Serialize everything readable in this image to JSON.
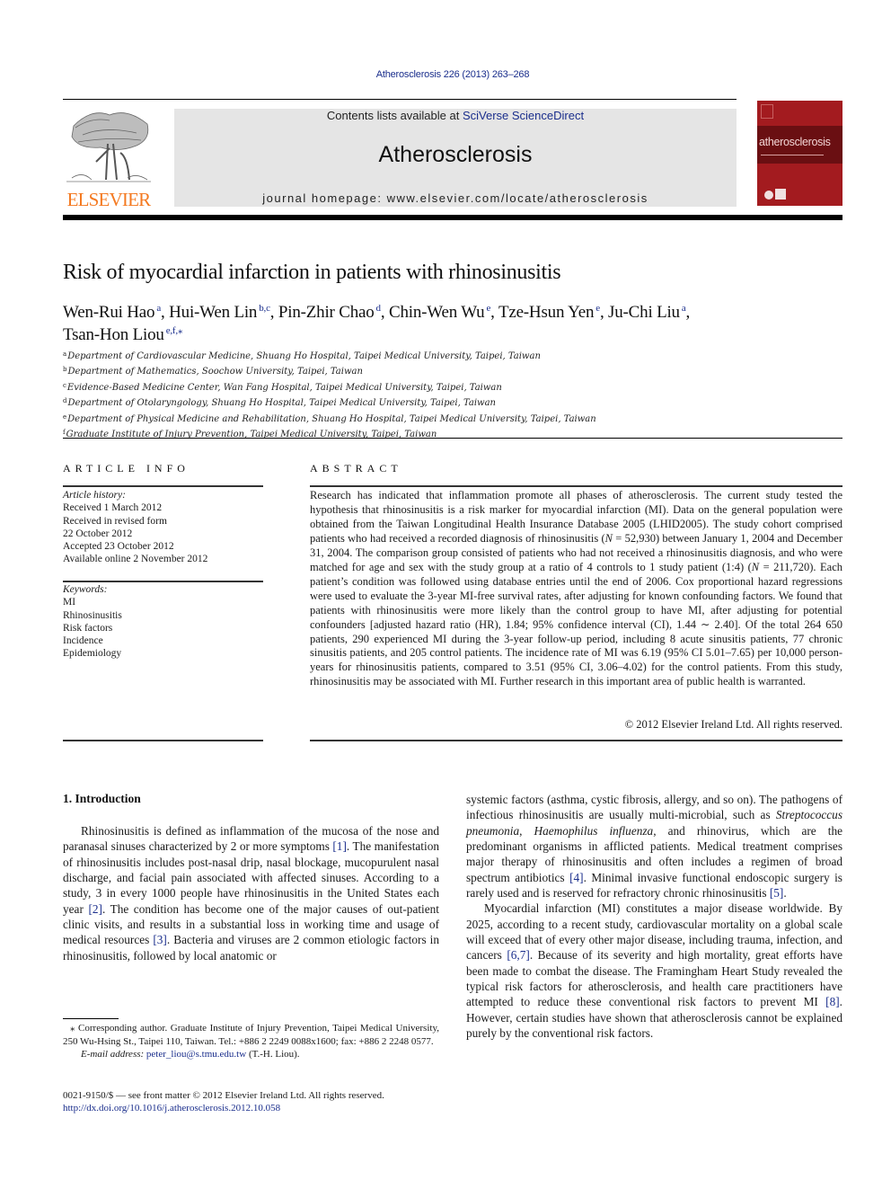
{
  "header": {
    "citation": "Atherosclerosis 226 (2013) 263–268",
    "publisher": "ELSEVIER",
    "contents_prefix": "Contents lists available at ",
    "contents_link": "SciVerse ScienceDirect",
    "journal_name": "Atherosclerosis",
    "homepage": "journal homepage: www.elsevier.com/locate/atherosclerosis",
    "cover_title": "atherosclerosis",
    "colors": {
      "publisher_orange": "#f47920",
      "link_blue": "#1a2e8c",
      "cover_red": "#a31b1f",
      "band_gray": "#e5e5e5"
    }
  },
  "article": {
    "title": "Risk of myocardial infarction in patients with rhinosinusitis",
    "authors": [
      {
        "name": "Wen-Rui Hao",
        "sup": "a",
        "sep": ", "
      },
      {
        "name": "Hui-Wen Lin",
        "sup": "b,c",
        "sep": ", "
      },
      {
        "name": "Pin-Zhir Chao",
        "sup": "d",
        "sep": ", "
      },
      {
        "name": "Chin-Wen Wu",
        "sup": "e",
        "sep": ", "
      },
      {
        "name": "Tze-Hsun Yen",
        "sup": "e",
        "sep": ", "
      },
      {
        "name": "Ju-Chi Liu",
        "sup": "a",
        "sep": ","
      },
      {
        "name": "Tsan-Hon Liou",
        "sup": "e,f,⁎",
        "sep": ""
      }
    ],
    "affiliations": [
      {
        "key": "a",
        "text": "Department of Cardiovascular Medicine, Shuang Ho Hospital, Taipei Medical University, Taipei, Taiwan"
      },
      {
        "key": "b",
        "text": "Department of Mathematics, Soochow University, Taipei, Taiwan"
      },
      {
        "key": "c",
        "text": "Evidence-Based Medicine Center, Wan Fang Hospital, Taipei Medical University, Taipei, Taiwan"
      },
      {
        "key": "d",
        "text": "Department of Otolaryngology, Shuang Ho Hospital, Taipei Medical University, Taipei, Taiwan"
      },
      {
        "key": "e",
        "text": "Department of Physical Medicine and Rehabilitation, Shuang Ho Hospital, Taipei Medical University, Taipei, Taiwan"
      },
      {
        "key": "f",
        "text": "Graduate Institute of Injury Prevention, Taipei Medical University, Taipei, Taiwan"
      }
    ]
  },
  "article_info": {
    "heading": "ARTICLE INFO",
    "history_label": "Article history:",
    "history": [
      "Received 1 March 2012",
      "Received in revised form",
      "22 October 2012",
      "Accepted 23 October 2012",
      "Available online 2 November 2012"
    ],
    "keywords_label": "Keywords:",
    "keywords": [
      "MI",
      "Rhinosinusitis",
      "Risk factors",
      "Incidence",
      "Epidemiology"
    ]
  },
  "abstract": {
    "heading": "ABSTRACT",
    "p1": "Research has indicated that inflammation promote all phases of atherosclerosis. The current study tested the hypothesis that rhinosinusitis is a risk marker for myocardial infarction (MI). Data on the general population were obtained from the Taiwan Longitudinal Health Insurance Database 2005 (LHID2005). The study cohort comprised patients who had received a recorded diagnosis of rhinosinusitis (",
    "n_var": "N",
    "p2": " = 52,930) between January 1, 2004 and December 31, 2004. The comparison group consisted of patients who had not received a rhinosinusitis diagnosis, and who were matched for age and sex with the study group at a ratio of 4 controls to 1 study patient (1:4) (",
    "p3": " = 211,720). Each patient’s condition was followed using database entries until the end of 2006. Cox proportional hazard regressions were used to evaluate the 3-year MI-free survival rates, after adjusting for known confounding factors. We found that patients with rhinosinusitis were more likely than the control group to have MI, after adjusting for potential confounders [adjusted hazard ratio (HR), 1.84; 95% confidence interval (CI), 1.44 ∼ 2.40]. Of the total 264 650 patients, 290 experienced MI during the 3-year follow-up period, including 8 acute sinusitis patients, 77 chronic sinusitis patients, and 205 control patients. The incidence rate of MI was 6.19 (95% CI 5.01–7.65) per 10,000 person-years for rhinosinusitis patients, compared to 3.51 (95% CI, 3.06–4.02) for the control patients. From this study, rhinosinusitis may be associated with MI. Further research in this important area of public health is warranted.",
    "copyright": "© 2012 Elsevier Ireland Ltd. All rights reserved."
  },
  "body": {
    "section_heading": "1.  Introduction",
    "left": {
      "s1": "Rhinosinusitis is defined as inflammation of the mucosa of the nose and paranasal sinuses characterized by 2 or more symptoms ",
      "r1": "[1]",
      "s2": ". The manifestation of rhinosinusitis includes post-nasal drip, nasal blockage, mucopurulent nasal discharge, and facial pain associated with affected sinuses. According to a study, 3 in every 1000 people have rhinosinusitis in the United States each year ",
      "r2": "[2]",
      "s3": ". The condition has become one of the major causes of out-patient clinic visits, and results in a substantial loss in working time and usage of medical resources ",
      "r3": "[3]",
      "s4": ". Bacteria and viruses are 2 common etiologic factors in rhinosinusitis, followed by local anatomic or"
    },
    "right": {
      "s1": "systemic factors (asthma, cystic fibrosis, allergy, and so on). The pathogens of infectious rhinosinusitis are usually multi-microbial, such as ",
      "i1": "Streptococcus pneumonia",
      "s2": ", ",
      "i2": "Haemophilus influenza",
      "s3": ", and rhinovirus, which are the predominant organisms in afflicted patients. Medical treatment comprises major therapy of rhinosinusitis and often includes a regimen of broad spectrum antibiotics ",
      "r4": "[4]",
      "s4": ". Minimal invasive functional endoscopic surgery is rarely used and is reserved for refractory chronic rhinosinusitis ",
      "r5": "[5]",
      "s5": ".",
      "p2a": "Myocardial infarction (MI) constitutes a major disease worldwide. By 2025, according to a recent study, cardiovascular mortality on a global scale will exceed that of every other major disease, including trauma, infection, and cancers ",
      "r67": "[6,7]",
      "p2b": ". Because of its severity and high mortality, great efforts have been made to combat the disease. The Framingham Heart Study revealed the typical risk factors for atherosclerosis, and health care practitioners have attempted to reduce these conventional risk factors to prevent MI ",
      "r8": "[8]",
      "p2c": ". However, certain studies have shown that atherosclerosis cannot be explained purely by the conventional risk factors."
    }
  },
  "footnote": {
    "corresponding": "⁎ Corresponding author. Graduate Institute of Injury Prevention, Taipei Medical University, 250 Wu-Hsing St., Taipei 110, Taiwan. Tel.: +886 2 2249 0088x1600; fax: +886 2 2248 0577.",
    "email_label": "E-mail address: ",
    "email": "peter_liou@s.tmu.edu.tw",
    "email_suffix": " (T.-H. Liou).",
    "front_matter": "0021-9150/$ — see front matter © 2012 Elsevier Ireland Ltd. All rights reserved.",
    "doi": "http://dx.doi.org/10.1016/j.atherosclerosis.2012.10.058"
  }
}
